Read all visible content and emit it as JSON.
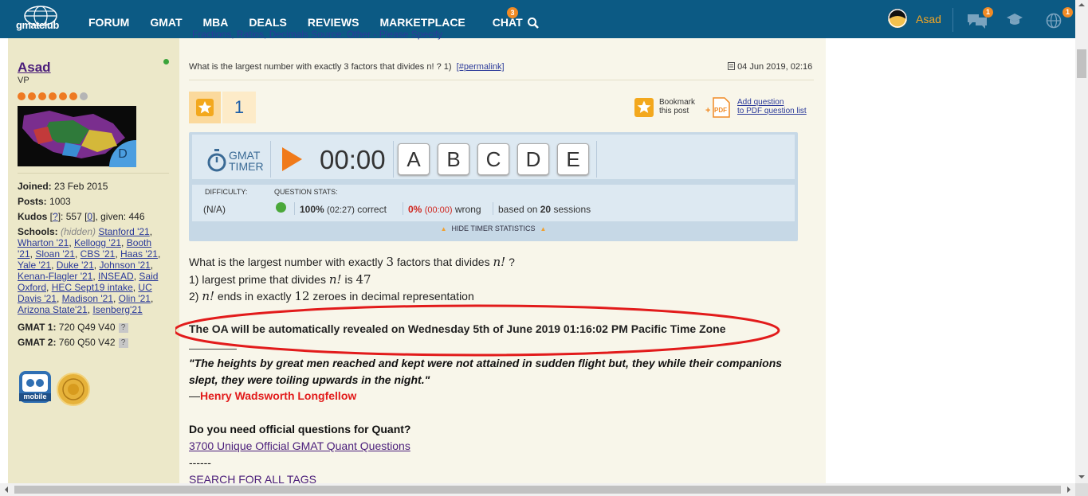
{
  "nav": {
    "logo_text": "gmatclub",
    "items": [
      "FORUM",
      "GMAT",
      "MBA",
      "DEALS",
      "REVIEWS",
      "MARKETPLACE",
      "CHAT"
    ],
    "chat_badge": "3",
    "user_name": "Asad",
    "notif_badges": [
      "1",
      "1"
    ]
  },
  "cut_links": "Fractions, Ratios, Decimals     Source: Other - Please Specify",
  "sidebar": {
    "username": "Asad",
    "rank": "VP",
    "avatar_letter": "D",
    "joined_label": "Joined:",
    "joined": "23 Feb 2015",
    "posts_label": "Posts:",
    "posts": "1003",
    "kudos_label": "Kudos",
    "kudos_help": "?",
    "kudos_value": "557",
    "kudos_link": "0",
    "kudos_given": ", given: 446",
    "schools_label": "Schools:",
    "schools_hidden": "(hidden)",
    "schools": [
      "Stanford '21",
      "Wharton '21",
      "Kellogg '21",
      "Booth '21",
      "Sloan '21",
      "CBS '21",
      "Haas '21",
      "Yale '21",
      "Duke '21",
      "Johnson '21",
      "Kenan-Flagler '21",
      "INSEAD",
      "Said Oxford",
      "HEC Sept19 intake",
      "UC Davis '21",
      "Madison '21",
      "Olin '21",
      "Arizona State'21",
      "Isenberg'21"
    ],
    "gmat1_label": "GMAT 1:",
    "gmat1": "720 Q49 V40",
    "gmat2_label": "GMAT 2:",
    "gmat2": "760 Q50 V42",
    "badge_mobile": "mobile"
  },
  "post": {
    "header": "What is the largest number with exactly 3 factors that divides n! ? 1)",
    "permalink": "[#permalink]",
    "date": "04 Jun 2019, 02:16",
    "kudos_count": "1",
    "bookmark_label": [
      "Bookmark",
      "this post"
    ],
    "pdf_label": [
      "Add question",
      "to PDF question list"
    ],
    "timer": {
      "logo": [
        "GMAT",
        "TIMER"
      ],
      "time": "00:00",
      "answers": [
        "A",
        "B",
        "C",
        "D",
        "E"
      ],
      "difficulty_label": "DIFFICULTY:",
      "difficulty": "(N/A)",
      "stats_label": "QUESTION STATS:",
      "correct_pct": "100%",
      "correct_time": "(02:27)",
      "correct_word": "correct",
      "wrong_pct": "0%",
      "wrong_time": "(00:00)",
      "wrong_word": "wrong",
      "based_pre": "based on",
      "sessions": "20",
      "sessions_word": "sessions",
      "hide_label": "HIDE TIMER STATISTICS"
    },
    "question": {
      "l1_a": "What is the largest number with exactly ",
      "l1_n": "3",
      "l1_b": " factors that divides ",
      "l1_v": "n!",
      "l1_c": " ?",
      "l2_a": "1) largest prime that divides ",
      "l2_v": "n!",
      "l2_b": " is ",
      "l2_n": "47",
      "l3_v": "n!",
      "l3_a": " ends in exactly ",
      "l3_n": "12",
      "l3_b": " zeroes in decimal representation"
    },
    "oa_notice": "The OA will be automatically revealed on Wednesday 5th of June 2019 01:16:02 PM Pacific Time Zone",
    "quote": "\"The heights by great men reached and kept were not attained in sudden flight but, they while their companions slept, they were toiling upwards in the night.\"",
    "author_dash": "—",
    "author": "Henry Wadsworth Longfellow",
    "need": "Do you need official questions for Quant?",
    "link_official": "3700 Unique Official GMAT Quant Questions",
    "dashes": "------",
    "link_tags": "SEARCH FOR ALL TAGS"
  },
  "colors": {
    "nav_bg": "#0c5a84",
    "accent_orange": "#f08a24",
    "highlight_red": "#e21b1b"
  }
}
